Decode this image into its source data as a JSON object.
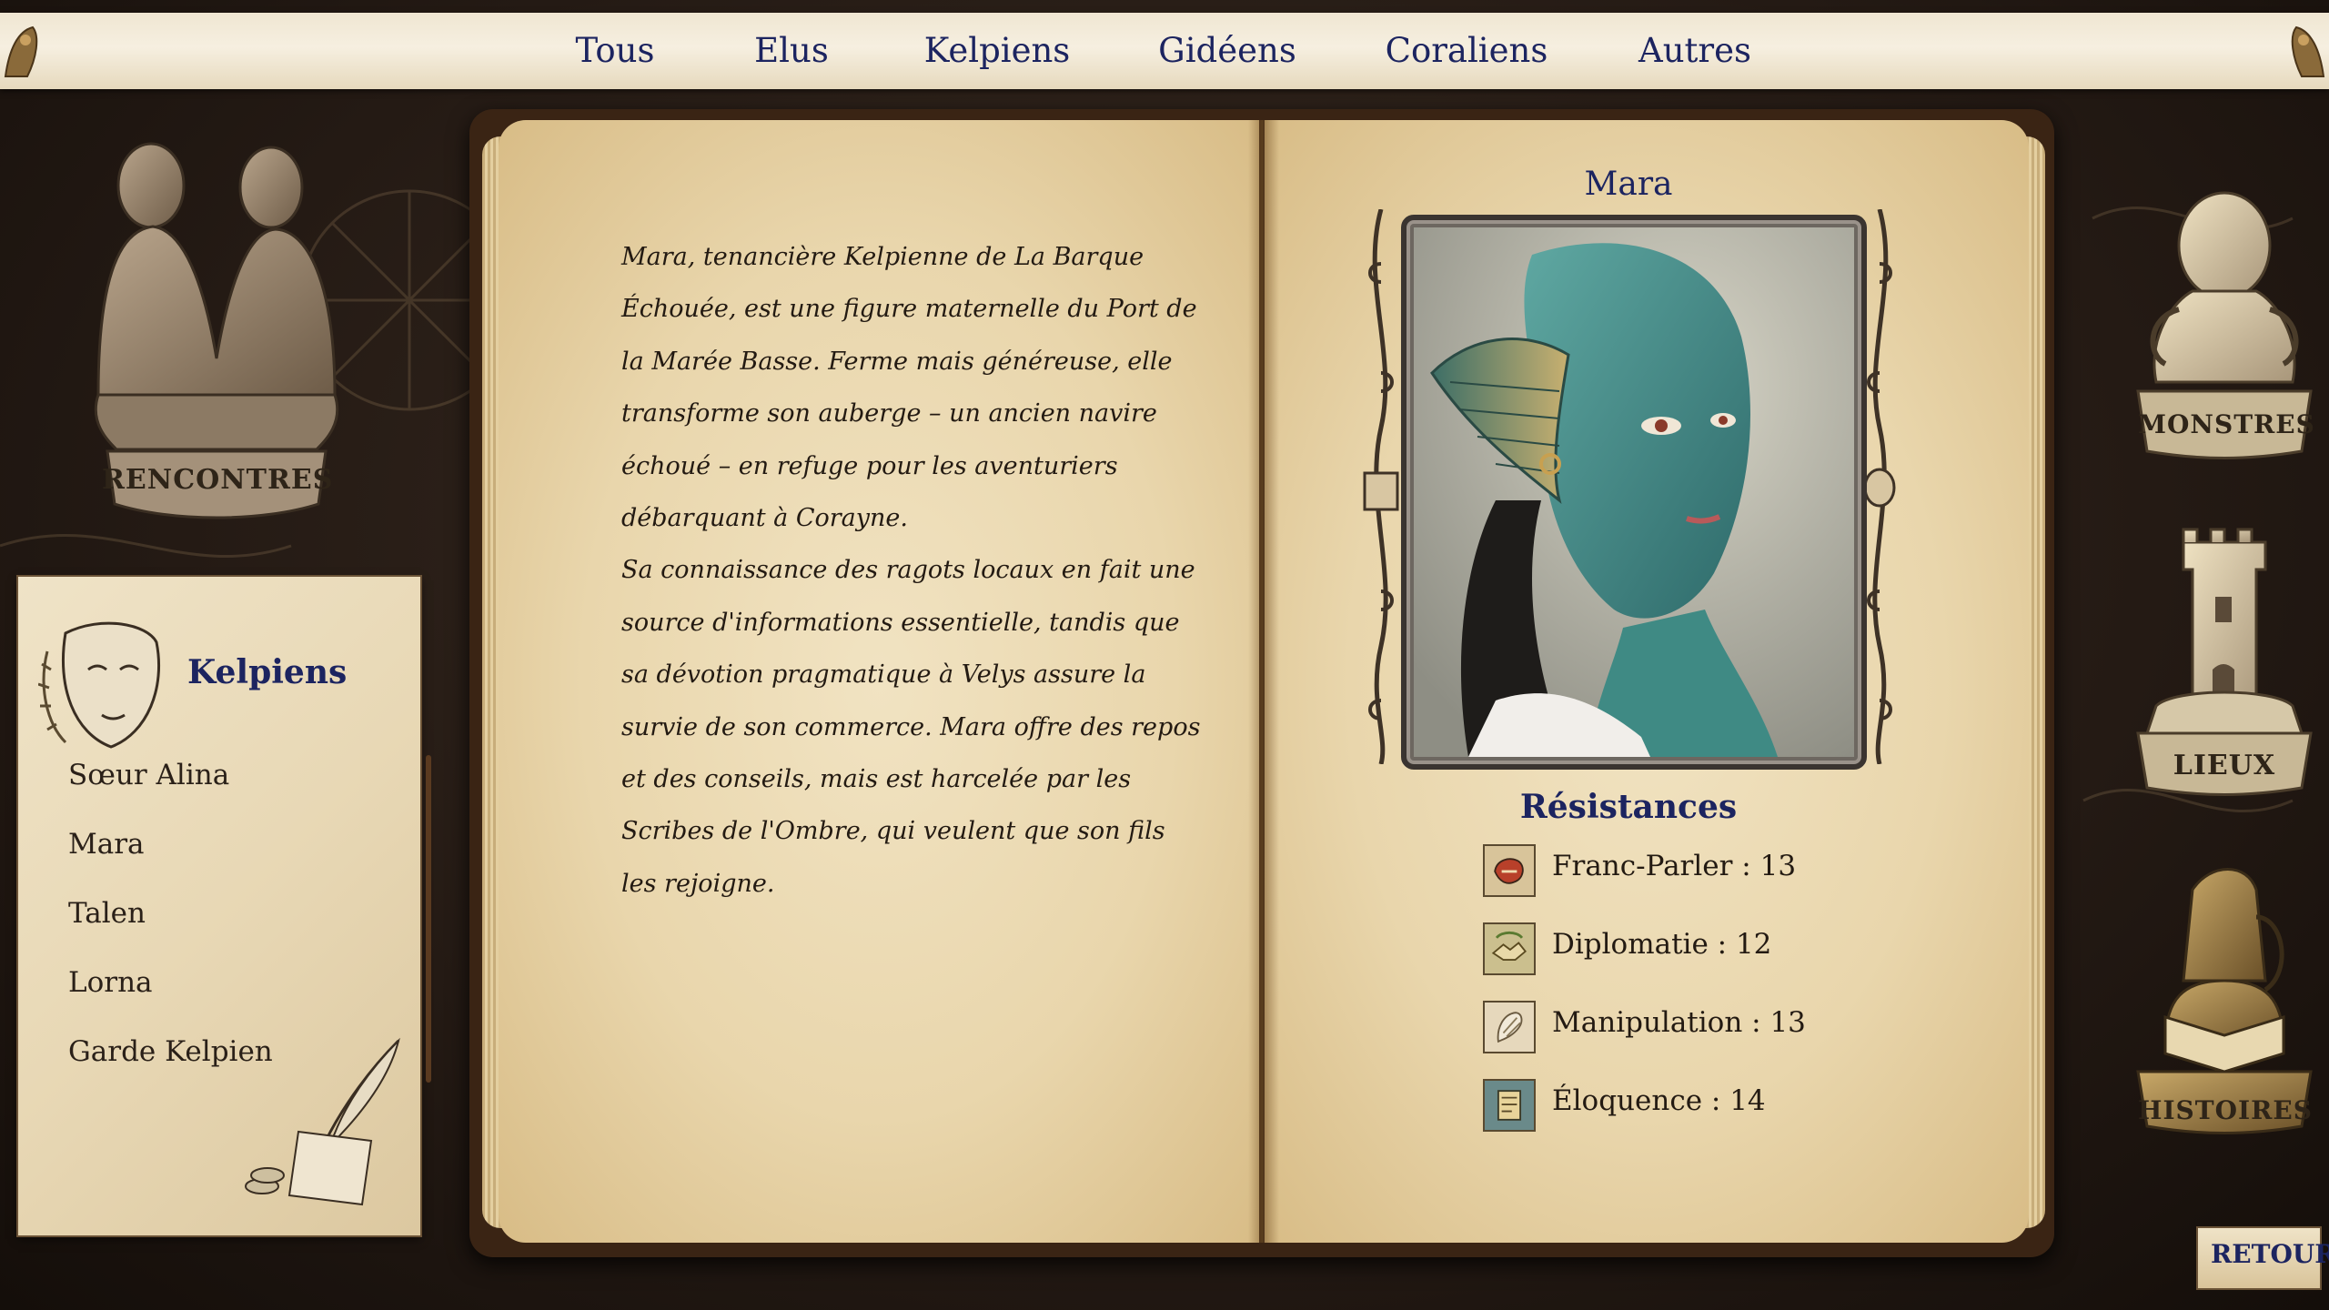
{
  "tabs": [
    {
      "label": "Tous"
    },
    {
      "label": "Elus"
    },
    {
      "label": "Kelpiens"
    },
    {
      "label": "Gidéens"
    },
    {
      "label": "Coraliens"
    },
    {
      "label": "Autres"
    }
  ],
  "left_statue": {
    "label": "RENCONTRES"
  },
  "right_statues": [
    {
      "label": "MONSTRES",
      "icon": "octopus-icon"
    },
    {
      "label": "LIEUX",
      "icon": "tower-icon"
    },
    {
      "label": "HISTOIRES",
      "icon": "bard-icon"
    }
  ],
  "category_panel": {
    "title": "Kelpiens",
    "items": [
      {
        "label": "Sœur Alina"
      },
      {
        "label": "Mara"
      },
      {
        "label": "Talen"
      },
      {
        "label": "Lorna"
      },
      {
        "label": "Garde Kelpien"
      }
    ]
  },
  "entry": {
    "name": "Mara",
    "description": [
      "Mara, tenancière Kelpienne de La Barque Échouée, est une figure maternelle du Port de la Marée Basse. Ferme mais généreuse, elle transforme son auberge – un ancien navire échoué – en refuge pour les aventuriers débarquant à Corayne.",
      "Sa connaissance des ragots locaux en fait une source d'informations essentielle, tandis que sa dévotion pragmatique à Velys assure la survie de son commerce. Mara offre des repos et des conseils, mais est harcelée par les Scribes de l'Ombre, qui veulent que son fils les rejoigne."
    ],
    "resistances_title": "Résistances",
    "resistances": [
      {
        "label": "Franc-Parler : 13",
        "icon": "frank-speech-icon"
      },
      {
        "label": "Diplomatie : 12",
        "icon": "diplomacy-icon"
      },
      {
        "label": "Manipulation : 13",
        "icon": "manipulation-icon"
      },
      {
        "label": "Éloquence : 14",
        "icon": "eloquence-icon"
      }
    ]
  },
  "back_button": {
    "label": "RETOUR"
  },
  "colors": {
    "tab_text": "#1c2460",
    "title_text": "#1c2460",
    "parchment": "#ecdcb6",
    "body_text": "#231a12"
  }
}
